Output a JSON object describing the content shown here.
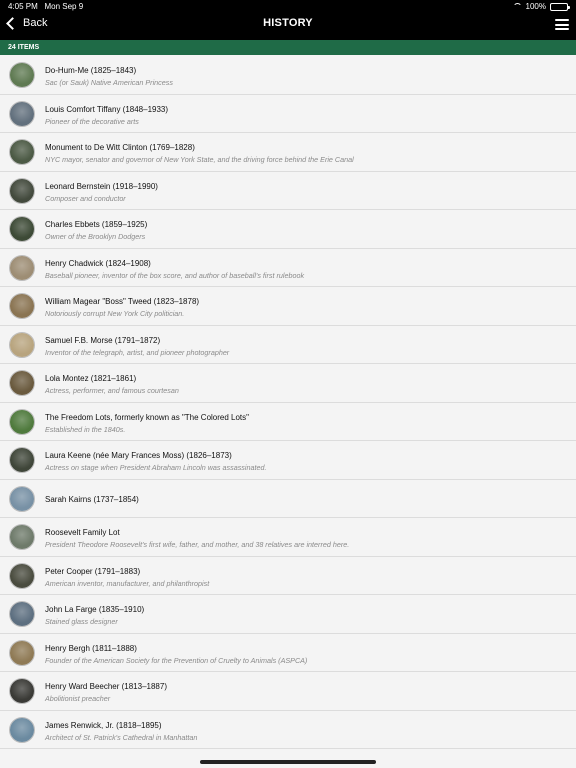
{
  "status_bar": {
    "time": "4:05 PM",
    "date": "Mon Sep 9",
    "battery": "100%"
  },
  "nav": {
    "back_label": "Back",
    "title": "HISTORY"
  },
  "count_label": "24 ITEMS",
  "items": [
    {
      "name": "Do-Hum-Me (1825–1843)",
      "subtitle": "Sac (or Sauk) Native American Princess",
      "thumb_color": "#5f7a52"
    },
    {
      "name": "Louis Comfort Tiffany (1848–1933)",
      "subtitle": "Pioneer of the decorative arts",
      "thumb_color": "#62707d"
    },
    {
      "name": "Monument to De Witt Clinton (1769–1828)",
      "subtitle": "NYC mayor, senator and governor of New York State, and the driving force behind the Erie Canal",
      "thumb_color": "#4c5a45"
    },
    {
      "name": "Leonard Bernstein (1918–1990)",
      "subtitle": "Composer and conductor",
      "thumb_color": "#434a3d"
    },
    {
      "name": "Charles Ebbets (1859–1925)",
      "subtitle": "Owner of the Brooklyn Dodgers",
      "thumb_color": "#3d4a36"
    },
    {
      "name": "Henry Chadwick (1824–1908)",
      "subtitle": "Baseball pioneer, inventor of the box score, and author of baseball's first rulebook",
      "thumb_color": "#9d8d74"
    },
    {
      "name": "William Magear \"Boss\" Tweed (1823–1878)",
      "subtitle": "Notoriously corrupt New York City politician.",
      "thumb_color": "#8a7452"
    },
    {
      "name": "Samuel F.B. Morse (1791–1872)",
      "subtitle": "Inventor of the telegraph, artist, and pioneer photographer",
      "thumb_color": "#b8a47e"
    },
    {
      "name": "Lola Montez (1821–1861)",
      "subtitle": "Actress, performer, and famous courtesan",
      "thumb_color": "#6a5a3e"
    },
    {
      "name": "The Freedom Lots, formerly known as \"The Colored Lots\"",
      "subtitle": "Established in the 1840s.",
      "thumb_color": "#4f7a3d"
    },
    {
      "name": "Laura Keene (née Mary Frances Moss) (1826–1873)",
      "subtitle": "Actress on stage when President Abraham Lincoln was assassinated.",
      "thumb_color": "#3f4639"
    },
    {
      "name": "Sarah Kairns (1737–1854)",
      "subtitle": "",
      "thumb_color": "#7891a5"
    },
    {
      "name": "Roosevelt Family Lot",
      "subtitle": "President Theodore Roosevelt's first wife, father, and mother, and 38 relatives are interred here.",
      "thumb_color": "#6e7a6a"
    },
    {
      "name": "Peter Cooper (1791–1883)",
      "subtitle": "American inventor, manufacturer, and philanthropist",
      "thumb_color": "#4a4c3f"
    },
    {
      "name": "John La Farge (1835–1910)",
      "subtitle": "Stained glass designer",
      "thumb_color": "#5d6f80"
    },
    {
      "name": "Henry Bergh (1811–1888)",
      "subtitle": "Founder of the American Society for the Prevention of Cruelty to Animals (ASPCA)",
      "thumb_color": "#8f7a55"
    },
    {
      "name": "Henry Ward Beecher (1813–1887)",
      "subtitle": "Abolitionist preacher",
      "thumb_color": "#3a3a36"
    },
    {
      "name": "James Renwick, Jr. (1818–1895)",
      "subtitle": "Architect of St. Patrick's Cathedral in Manhattan",
      "thumb_color": "#6b8aa0"
    }
  ]
}
